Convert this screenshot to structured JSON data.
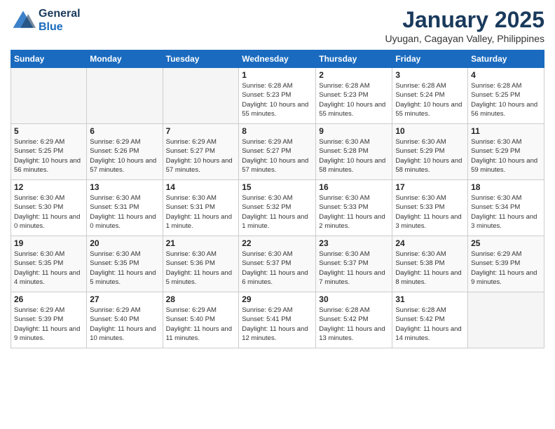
{
  "header": {
    "logo_line1": "General",
    "logo_line2": "Blue",
    "month": "January 2025",
    "location": "Uyugan, Cagayan Valley, Philippines"
  },
  "weekdays": [
    "Sunday",
    "Monday",
    "Tuesday",
    "Wednesday",
    "Thursday",
    "Friday",
    "Saturday"
  ],
  "weeks": [
    [
      {
        "num": "",
        "empty": true
      },
      {
        "num": "",
        "empty": true
      },
      {
        "num": "",
        "empty": true
      },
      {
        "num": "1",
        "rise": "6:28 AM",
        "set": "5:23 PM",
        "daylight": "10 hours and 55 minutes."
      },
      {
        "num": "2",
        "rise": "6:28 AM",
        "set": "5:23 PM",
        "daylight": "10 hours and 55 minutes."
      },
      {
        "num": "3",
        "rise": "6:28 AM",
        "set": "5:24 PM",
        "daylight": "10 hours and 55 minutes."
      },
      {
        "num": "4",
        "rise": "6:28 AM",
        "set": "5:25 PM",
        "daylight": "10 hours and 56 minutes."
      }
    ],
    [
      {
        "num": "5",
        "rise": "6:29 AM",
        "set": "5:25 PM",
        "daylight": "10 hours and 56 minutes."
      },
      {
        "num": "6",
        "rise": "6:29 AM",
        "set": "5:26 PM",
        "daylight": "10 hours and 57 minutes."
      },
      {
        "num": "7",
        "rise": "6:29 AM",
        "set": "5:27 PM",
        "daylight": "10 hours and 57 minutes."
      },
      {
        "num": "8",
        "rise": "6:29 AM",
        "set": "5:27 PM",
        "daylight": "10 hours and 57 minutes."
      },
      {
        "num": "9",
        "rise": "6:30 AM",
        "set": "5:28 PM",
        "daylight": "10 hours and 58 minutes."
      },
      {
        "num": "10",
        "rise": "6:30 AM",
        "set": "5:29 PM",
        "daylight": "10 hours and 58 minutes."
      },
      {
        "num": "11",
        "rise": "6:30 AM",
        "set": "5:29 PM",
        "daylight": "10 hours and 59 minutes."
      }
    ],
    [
      {
        "num": "12",
        "rise": "6:30 AM",
        "set": "5:30 PM",
        "daylight": "11 hours and 0 minutes."
      },
      {
        "num": "13",
        "rise": "6:30 AM",
        "set": "5:31 PM",
        "daylight": "11 hours and 0 minutes."
      },
      {
        "num": "14",
        "rise": "6:30 AM",
        "set": "5:31 PM",
        "daylight": "11 hours and 1 minute."
      },
      {
        "num": "15",
        "rise": "6:30 AM",
        "set": "5:32 PM",
        "daylight": "11 hours and 1 minute."
      },
      {
        "num": "16",
        "rise": "6:30 AM",
        "set": "5:33 PM",
        "daylight": "11 hours and 2 minutes."
      },
      {
        "num": "17",
        "rise": "6:30 AM",
        "set": "5:33 PM",
        "daylight": "11 hours and 3 minutes."
      },
      {
        "num": "18",
        "rise": "6:30 AM",
        "set": "5:34 PM",
        "daylight": "11 hours and 3 minutes."
      }
    ],
    [
      {
        "num": "19",
        "rise": "6:30 AM",
        "set": "5:35 PM",
        "daylight": "11 hours and 4 minutes."
      },
      {
        "num": "20",
        "rise": "6:30 AM",
        "set": "5:35 PM",
        "daylight": "11 hours and 5 minutes."
      },
      {
        "num": "21",
        "rise": "6:30 AM",
        "set": "5:36 PM",
        "daylight": "11 hours and 5 minutes."
      },
      {
        "num": "22",
        "rise": "6:30 AM",
        "set": "5:37 PM",
        "daylight": "11 hours and 6 minutes."
      },
      {
        "num": "23",
        "rise": "6:30 AM",
        "set": "5:37 PM",
        "daylight": "11 hours and 7 minutes."
      },
      {
        "num": "24",
        "rise": "6:30 AM",
        "set": "5:38 PM",
        "daylight": "11 hours and 8 minutes."
      },
      {
        "num": "25",
        "rise": "6:29 AM",
        "set": "5:39 PM",
        "daylight": "11 hours and 9 minutes."
      }
    ],
    [
      {
        "num": "26",
        "rise": "6:29 AM",
        "set": "5:39 PM",
        "daylight": "11 hours and 9 minutes."
      },
      {
        "num": "27",
        "rise": "6:29 AM",
        "set": "5:40 PM",
        "daylight": "11 hours and 10 minutes."
      },
      {
        "num": "28",
        "rise": "6:29 AM",
        "set": "5:40 PM",
        "daylight": "11 hours and 11 minutes."
      },
      {
        "num": "29",
        "rise": "6:29 AM",
        "set": "5:41 PM",
        "daylight": "11 hours and 12 minutes."
      },
      {
        "num": "30",
        "rise": "6:28 AM",
        "set": "5:42 PM",
        "daylight": "11 hours and 13 minutes."
      },
      {
        "num": "31",
        "rise": "6:28 AM",
        "set": "5:42 PM",
        "daylight": "11 hours and 14 minutes."
      },
      {
        "num": "",
        "empty": true
      }
    ]
  ]
}
